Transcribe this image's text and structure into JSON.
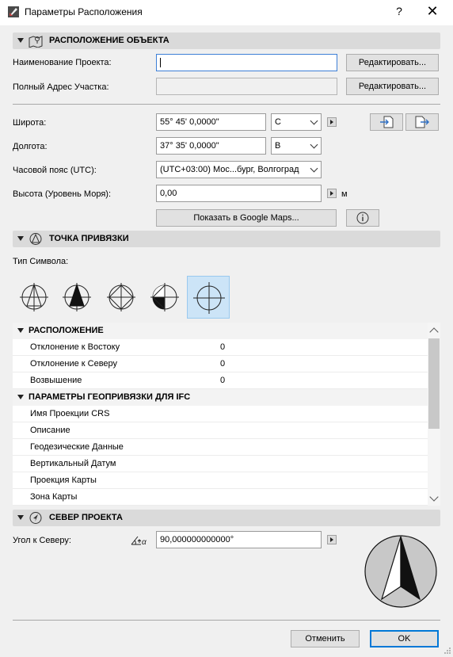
{
  "window": {
    "title": "Параметры Расположения",
    "help": "?",
    "close": "✕"
  },
  "location_section": {
    "title": "РАСПОЛОЖЕНИЕ ОБЪЕКТА"
  },
  "project_name": {
    "label": "Наименование Проекта:",
    "value": "",
    "button": "Редактировать..."
  },
  "site_address": {
    "label": "Полный Адрес Участка:",
    "value": "",
    "button": "Редактировать..."
  },
  "latitude": {
    "label": "Широта:",
    "value": "55° 45' 0,0000\"",
    "direction": "С"
  },
  "longitude": {
    "label": "Долгота:",
    "value": "37° 35' 0,0000\"",
    "direction": "В"
  },
  "timezone": {
    "label": "Часовой пояс (UTC):",
    "value": "(UTC+03:00) Мос...бург, Волгоград"
  },
  "altitude": {
    "label": "Высота (Уровень Моря):",
    "value": "0,00",
    "unit": "м"
  },
  "google_maps_button": "Показать в Google Maps...",
  "anchor_section": {
    "title": "ТОЧКА ПРИВЯЗКИ"
  },
  "symbol_type_label": "Тип Символа:",
  "symbols": [
    {
      "icon": "survey-point-outline-icon",
      "selected": false
    },
    {
      "icon": "survey-point-filled-icon",
      "selected": false
    },
    {
      "icon": "crosshair-circle-icon",
      "selected": false
    },
    {
      "icon": "crosshair-quadrant-icon",
      "selected": false
    },
    {
      "icon": "crosshair-icon",
      "selected": true
    }
  ],
  "tree": {
    "placement_group": "РАСПОЛОЖЕНИЕ",
    "placement_rows": [
      {
        "label": "Отклонение к Востоку",
        "value": "0"
      },
      {
        "label": "Отклонение к Северу",
        "value": "0"
      },
      {
        "label": "Возвышение",
        "value": "0"
      }
    ],
    "ifc_group": "ПАРАМЕТРЫ ГЕОПРИВЯЗКИ ДЛЯ IFC",
    "ifc_rows": [
      {
        "label": "Имя Проекции CRS",
        "value": ""
      },
      {
        "label": "Описание",
        "value": ""
      },
      {
        "label": "Геодезические Данные",
        "value": ""
      },
      {
        "label": "Вертикальный Датум",
        "value": ""
      },
      {
        "label": "Проекция Карты",
        "value": ""
      },
      {
        "label": "Зона Карты",
        "value": ""
      }
    ]
  },
  "north_section": {
    "title": "СЕВЕР ПРОЕКТА"
  },
  "north_angle": {
    "label": "Угол к Северу:",
    "value": "90,000000000000°",
    "angle_symbol": "α"
  },
  "footer": {
    "cancel": "Отменить",
    "ok": "OK"
  },
  "colors": {
    "header_bg": "#dadada",
    "selected_bg": "#cce4f7",
    "focus_border": "#3d7fd6"
  }
}
